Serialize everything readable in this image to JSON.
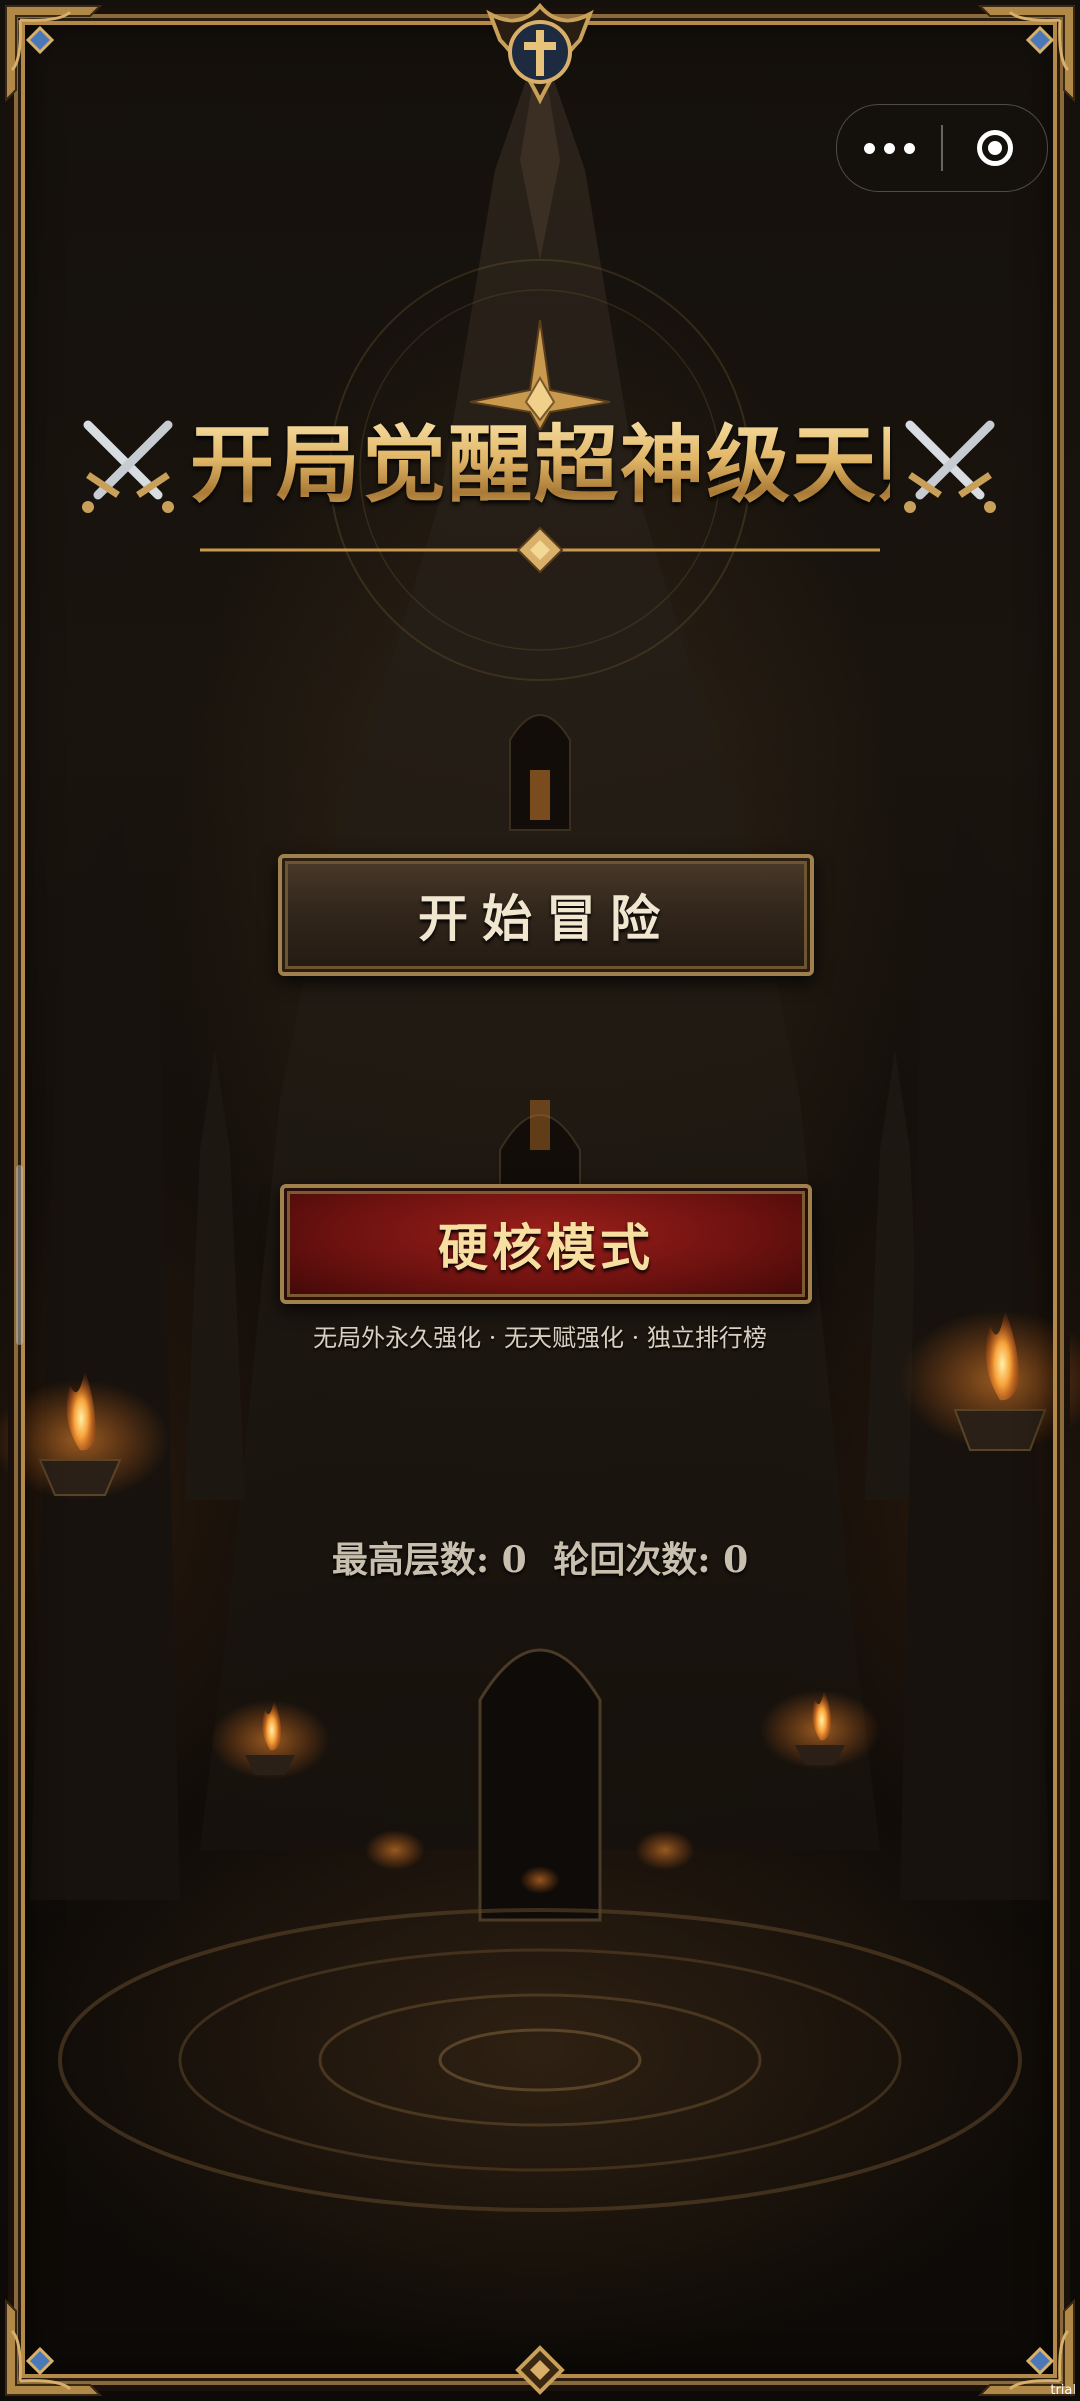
{
  "capsule": {
    "more_icon": "ellipsis-icon",
    "close_icon": "target-circle-icon"
  },
  "title": {
    "text": "开局觉醒超神级天赋",
    "left_icon": "crossed-swords-icon",
    "right_icon": "crossed-swords-icon"
  },
  "menu": {
    "start_label": "开始冒险",
    "hardcore_label": "硬核模式",
    "hardcore_desc": "无局外永久强化 · 无天赋强化 · 独立排行榜"
  },
  "stats": {
    "highest_floor_label": "最高层数:",
    "highest_floor_value": "0",
    "rebirth_label": "轮回次数:",
    "rebirth_value": "0"
  },
  "watermark": "trial version",
  "colors": {
    "gold": "#e0b566",
    "hardcore_red": "#7a1512",
    "frame": "#8a6a3a"
  }
}
